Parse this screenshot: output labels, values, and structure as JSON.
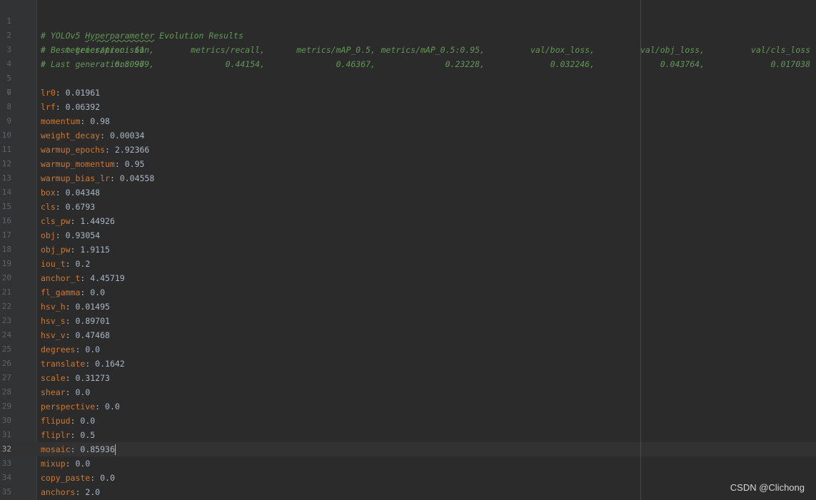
{
  "editor": {
    "comments": {
      "title_prefix": "# YOLOv5 ",
      "title_squiggle": "Hyperparameter",
      "title_suffix": " Evolution Results",
      "best_generation": "# Best generation: 61",
      "last_generation": "# Last generation: 97",
      "metrics_prefix": "#",
      "metrics_headers": [
        "metrics/precision,",
        "metrics/recall,",
        "metrics/mAP_0.5,",
        "metrics/mAP_0.5:0.95,",
        "val/box_loss,",
        "val/obj_loss,",
        "val/cls_loss"
      ],
      "metrics_values": [
        "0.80969,",
        "0.44154,",
        "0.46367,",
        "0.23228,",
        "0.032246,",
        "0.043764,",
        "0.017038"
      ]
    },
    "line_numbers": [
      "1",
      "2",
      "3",
      "4",
      "5",
      "6",
      "7",
      "8",
      "9",
      "10",
      "11",
      "12",
      "13",
      "14",
      "15",
      "16",
      "17",
      "18",
      "19",
      "20",
      "21",
      "22",
      "23",
      "24",
      "25",
      "26",
      "27",
      "28",
      "29",
      "30",
      "31",
      "32",
      "33",
      "34",
      "35"
    ],
    "active_line": "32",
    "params": [
      {
        "key": "lr0",
        "value": "0.01961"
      },
      {
        "key": "lrf",
        "value": "0.06392"
      },
      {
        "key": "momentum",
        "value": "0.98"
      },
      {
        "key": "weight_decay",
        "value": "0.00034"
      },
      {
        "key": "warmup_epochs",
        "value": "2.92366"
      },
      {
        "key": "warmup_momentum",
        "value": "0.95"
      },
      {
        "key": "warmup_bias_lr",
        "value": "0.04558"
      },
      {
        "key": "box",
        "value": "0.04348"
      },
      {
        "key": "cls",
        "value": "0.6793"
      },
      {
        "key": "cls_pw",
        "value": "1.44926"
      },
      {
        "key": "obj",
        "value": "0.93054"
      },
      {
        "key": "obj_pw",
        "value": "1.9115"
      },
      {
        "key": "iou_t",
        "value": "0.2"
      },
      {
        "key": "anchor_t",
        "value": "4.45719"
      },
      {
        "key": "fl_gamma",
        "value": "0.0"
      },
      {
        "key": "hsv_h",
        "value": "0.01495"
      },
      {
        "key": "hsv_s",
        "value": "0.89701"
      },
      {
        "key": "hsv_v",
        "value": "0.47468"
      },
      {
        "key": "degrees",
        "value": "0.0"
      },
      {
        "key": "translate",
        "value": "0.1642"
      },
      {
        "key": "scale",
        "value": "0.31273"
      },
      {
        "key": "shear",
        "value": "0.0"
      },
      {
        "key": "perspective",
        "value": "0.0"
      },
      {
        "key": "flipud",
        "value": "0.0"
      },
      {
        "key": "fliplr",
        "value": "0.5"
      },
      {
        "key": "mosaic",
        "value": "0.85936"
      },
      {
        "key": "mixup",
        "value": "0.0"
      },
      {
        "key": "copy_paste",
        "value": "0.0"
      },
      {
        "key": "anchors",
        "value": "2.0"
      }
    ],
    "colon": ": "
  },
  "watermark": "CSDN @Clichong",
  "colors": {
    "background": "#2b2b2b",
    "gutter": "#313335",
    "comment": "#629755",
    "key": "#cc7832",
    "value": "#a9b7c6",
    "line_number": "#606366"
  }
}
